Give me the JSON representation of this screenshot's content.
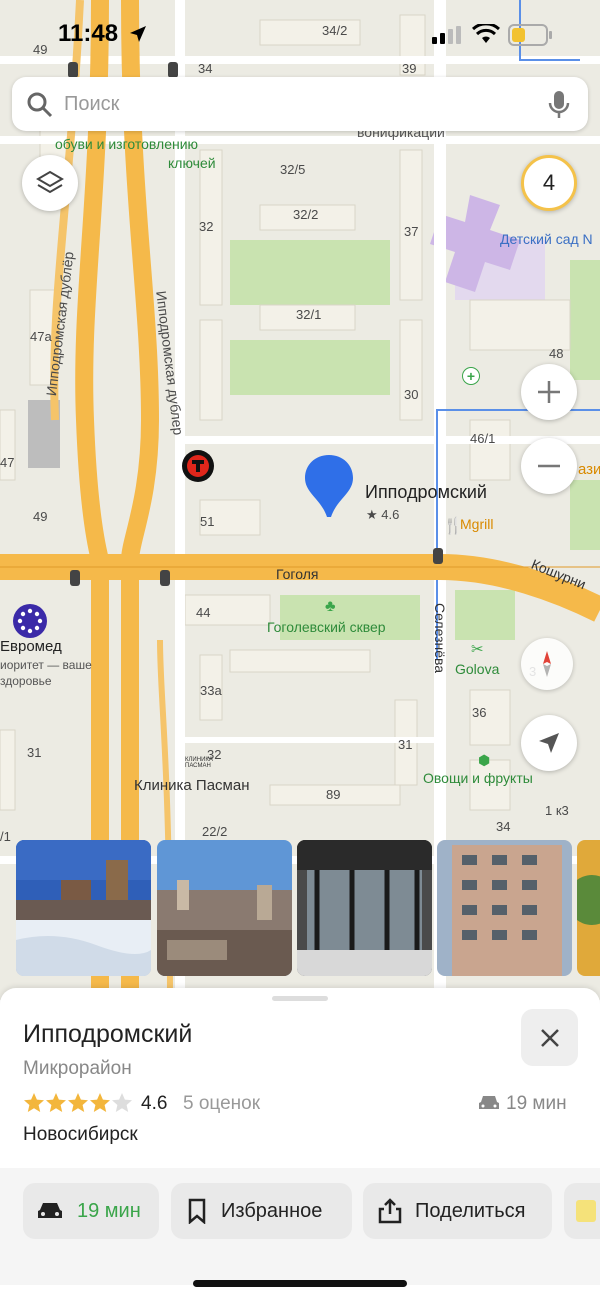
{
  "status": {
    "time": "11:48"
  },
  "search": {
    "placeholder": "Поиск"
  },
  "map": {
    "traffic_level": "4",
    "labels": {
      "house_49_top": "49",
      "house_34_top": "34",
      "house_342": "34/2",
      "house_39": "39",
      "shop_shoes": "обуви и изготовлению",
      "shop_keys": "ключей",
      "unification": "вонификации",
      "house_325": "32/5",
      "house_32": "32",
      "house_322": "32/2",
      "house_37": "37",
      "kindergarten": "Детский сад N",
      "house_47a": "47а",
      "street_dubler_left": "Ипподромская дублёр",
      "street_dubler_right": "Ипподромская дублер",
      "house_321": "32/1",
      "house_48": "48",
      "house_30": "30",
      "house_461": "46/1",
      "house_47": "47",
      "place_name": "Ипподромский",
      "place_rating": "★ 4.6",
      "house_49": "49",
      "house_51": "51",
      "mgrill": "Mgrill",
      "street_gogolya": "Гоголя",
      "street_koshurn": "Кошурни",
      "evromed": "Евромед",
      "evromed_slogan1": "иоритет — ваше",
      "evromed_slogan2": "здоровье",
      "house_44": "44",
      "gogol_square": "Гоголевский сквер",
      "street_selezneva": "Селезнёва",
      "golova": "Golova",
      "house_33a": "33а",
      "house_36": "36",
      "house_31_left": "31",
      "house_32_low": "32",
      "house_31": "31",
      "veggies": "Овощи и фрукты",
      "clinic": "Клиника Пасман",
      "clinic_sign": "КЛИНИКА ПАСМАН",
      "house_89": "89",
      "house_1k3": "1 к3",
      "house_34_low": "34",
      "house_222": "22/2",
      "house_1": "/1",
      "house_azi": "ази",
      "house_3": "3"
    }
  },
  "place": {
    "name": "Ипподромский",
    "type": "Микрорайон",
    "rating": 4.6,
    "rating_text": "4.6",
    "rating_count": "5 оценок",
    "drive_time": "19 мин",
    "city": "Новосибирск"
  },
  "actions": {
    "route": "19 мин",
    "favorite": "Избранное",
    "share": "Поделиться"
  },
  "colors": {
    "accent_green": "#3aa54a",
    "road_orange": "#f5b94a",
    "pin_blue": "#2f6fe8",
    "star_gold": "#f3b63c"
  }
}
